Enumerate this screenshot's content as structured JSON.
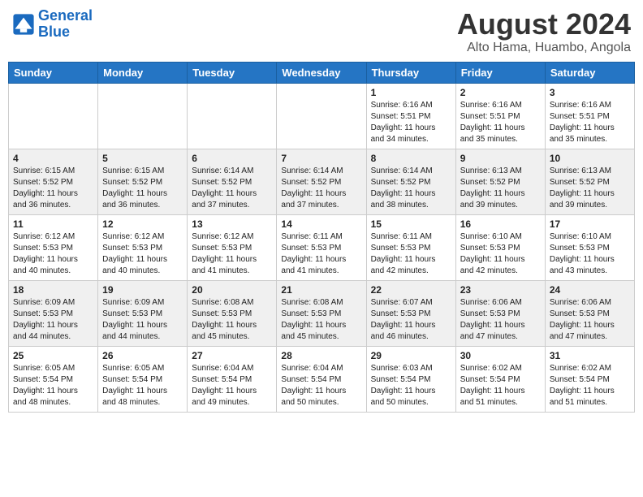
{
  "logo": {
    "line1": "General",
    "line2": "Blue"
  },
  "title": "August 2024",
  "location": "Alto Hama, Huambo, Angola",
  "days_of_week": [
    "Sunday",
    "Monday",
    "Tuesday",
    "Wednesday",
    "Thursday",
    "Friday",
    "Saturday"
  ],
  "weeks": [
    [
      {
        "day": "",
        "info": ""
      },
      {
        "day": "",
        "info": ""
      },
      {
        "day": "",
        "info": ""
      },
      {
        "day": "",
        "info": ""
      },
      {
        "day": "1",
        "info": "Sunrise: 6:16 AM\nSunset: 5:51 PM\nDaylight: 11 hours\nand 34 minutes."
      },
      {
        "day": "2",
        "info": "Sunrise: 6:16 AM\nSunset: 5:51 PM\nDaylight: 11 hours\nand 35 minutes."
      },
      {
        "day": "3",
        "info": "Sunrise: 6:16 AM\nSunset: 5:51 PM\nDaylight: 11 hours\nand 35 minutes."
      }
    ],
    [
      {
        "day": "4",
        "info": "Sunrise: 6:15 AM\nSunset: 5:52 PM\nDaylight: 11 hours\nand 36 minutes."
      },
      {
        "day": "5",
        "info": "Sunrise: 6:15 AM\nSunset: 5:52 PM\nDaylight: 11 hours\nand 36 minutes."
      },
      {
        "day": "6",
        "info": "Sunrise: 6:14 AM\nSunset: 5:52 PM\nDaylight: 11 hours\nand 37 minutes."
      },
      {
        "day": "7",
        "info": "Sunrise: 6:14 AM\nSunset: 5:52 PM\nDaylight: 11 hours\nand 37 minutes."
      },
      {
        "day": "8",
        "info": "Sunrise: 6:14 AM\nSunset: 5:52 PM\nDaylight: 11 hours\nand 38 minutes."
      },
      {
        "day": "9",
        "info": "Sunrise: 6:13 AM\nSunset: 5:52 PM\nDaylight: 11 hours\nand 39 minutes."
      },
      {
        "day": "10",
        "info": "Sunrise: 6:13 AM\nSunset: 5:52 PM\nDaylight: 11 hours\nand 39 minutes."
      }
    ],
    [
      {
        "day": "11",
        "info": "Sunrise: 6:12 AM\nSunset: 5:53 PM\nDaylight: 11 hours\nand 40 minutes."
      },
      {
        "day": "12",
        "info": "Sunrise: 6:12 AM\nSunset: 5:53 PM\nDaylight: 11 hours\nand 40 minutes."
      },
      {
        "day": "13",
        "info": "Sunrise: 6:12 AM\nSunset: 5:53 PM\nDaylight: 11 hours\nand 41 minutes."
      },
      {
        "day": "14",
        "info": "Sunrise: 6:11 AM\nSunset: 5:53 PM\nDaylight: 11 hours\nand 41 minutes."
      },
      {
        "day": "15",
        "info": "Sunrise: 6:11 AM\nSunset: 5:53 PM\nDaylight: 11 hours\nand 42 minutes."
      },
      {
        "day": "16",
        "info": "Sunrise: 6:10 AM\nSunset: 5:53 PM\nDaylight: 11 hours\nand 42 minutes."
      },
      {
        "day": "17",
        "info": "Sunrise: 6:10 AM\nSunset: 5:53 PM\nDaylight: 11 hours\nand 43 minutes."
      }
    ],
    [
      {
        "day": "18",
        "info": "Sunrise: 6:09 AM\nSunset: 5:53 PM\nDaylight: 11 hours\nand 44 minutes."
      },
      {
        "day": "19",
        "info": "Sunrise: 6:09 AM\nSunset: 5:53 PM\nDaylight: 11 hours\nand 44 minutes."
      },
      {
        "day": "20",
        "info": "Sunrise: 6:08 AM\nSunset: 5:53 PM\nDaylight: 11 hours\nand 45 minutes."
      },
      {
        "day": "21",
        "info": "Sunrise: 6:08 AM\nSunset: 5:53 PM\nDaylight: 11 hours\nand 45 minutes."
      },
      {
        "day": "22",
        "info": "Sunrise: 6:07 AM\nSunset: 5:53 PM\nDaylight: 11 hours\nand 46 minutes."
      },
      {
        "day": "23",
        "info": "Sunrise: 6:06 AM\nSunset: 5:53 PM\nDaylight: 11 hours\nand 47 minutes."
      },
      {
        "day": "24",
        "info": "Sunrise: 6:06 AM\nSunset: 5:53 PM\nDaylight: 11 hours\nand 47 minutes."
      }
    ],
    [
      {
        "day": "25",
        "info": "Sunrise: 6:05 AM\nSunset: 5:54 PM\nDaylight: 11 hours\nand 48 minutes."
      },
      {
        "day": "26",
        "info": "Sunrise: 6:05 AM\nSunset: 5:54 PM\nDaylight: 11 hours\nand 48 minutes."
      },
      {
        "day": "27",
        "info": "Sunrise: 6:04 AM\nSunset: 5:54 PM\nDaylight: 11 hours\nand 49 minutes."
      },
      {
        "day": "28",
        "info": "Sunrise: 6:04 AM\nSunset: 5:54 PM\nDaylight: 11 hours\nand 50 minutes."
      },
      {
        "day": "29",
        "info": "Sunrise: 6:03 AM\nSunset: 5:54 PM\nDaylight: 11 hours\nand 50 minutes."
      },
      {
        "day": "30",
        "info": "Sunrise: 6:02 AM\nSunset: 5:54 PM\nDaylight: 11 hours\nand 51 minutes."
      },
      {
        "day": "31",
        "info": "Sunrise: 6:02 AM\nSunset: 5:54 PM\nDaylight: 11 hours\nand 51 minutes."
      }
    ]
  ]
}
